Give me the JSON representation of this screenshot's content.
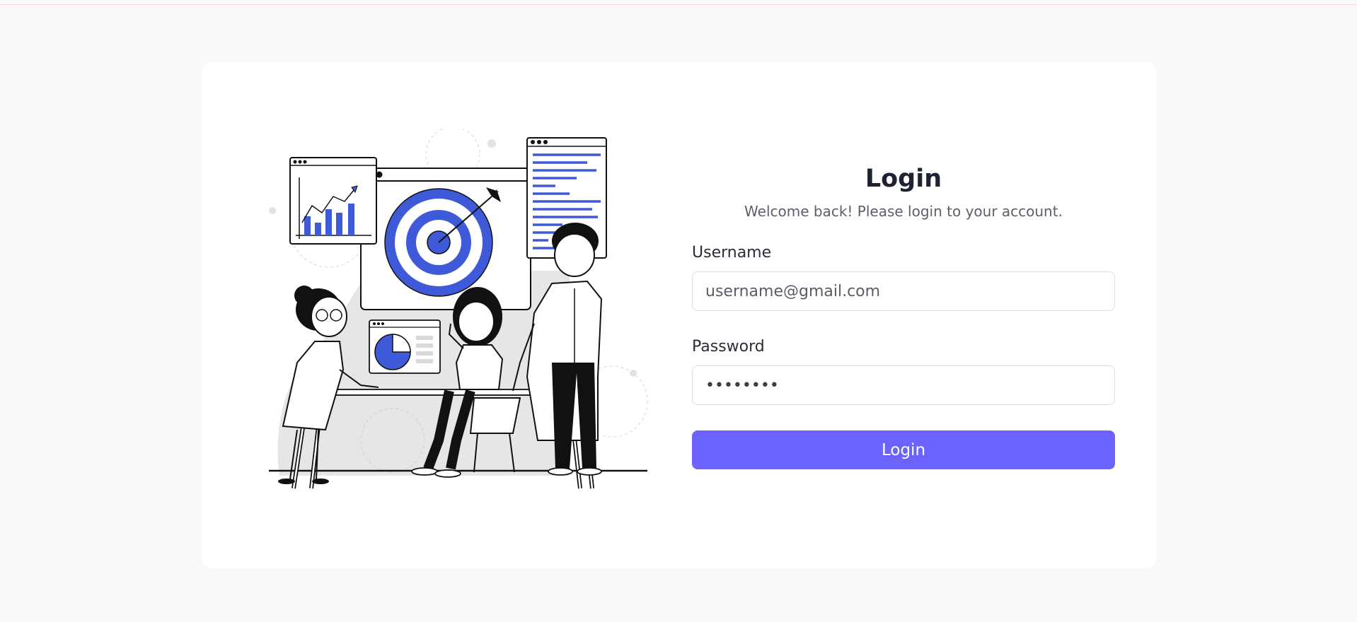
{
  "login": {
    "title": "Login",
    "subtitle": "Welcome back! Please login to your account.",
    "username_label": "Username",
    "username_placeholder": "username@gmail.com",
    "username_value": "",
    "password_label": "Password",
    "password_value": "password",
    "submit_label": "Login"
  },
  "colors": {
    "page_background": "#f8f9fb",
    "card_background": "#ffffff",
    "accent": "#6c63ff",
    "illustration_blue": "#3f5ad8"
  },
  "illustration": {
    "icon": "team-target-analytics-illustration"
  }
}
